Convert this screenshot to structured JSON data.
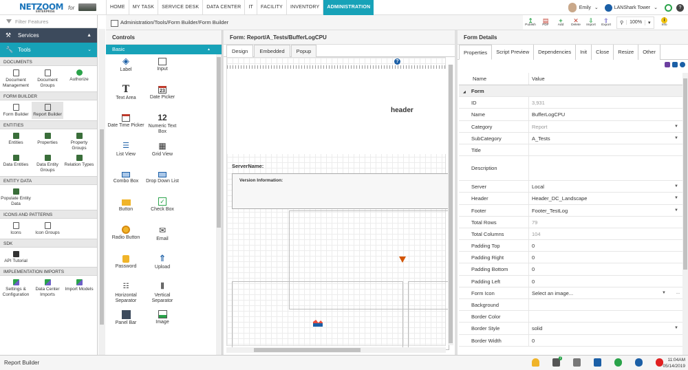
{
  "logo": {
    "name": "NETZOOM",
    "sub": "ENTERPRISE",
    "for": "for"
  },
  "nav": [
    "HOME",
    "MY TASK",
    "SERVICE DESK",
    "DATA CENTER",
    "IT",
    "FACILITY",
    "INVENTORY",
    "ADMINISTRATION"
  ],
  "user": {
    "name": "Emily",
    "site": "LANShark Tower"
  },
  "left": {
    "filter_placeholder": "Filter Features",
    "services": "Services",
    "tools": "Tools",
    "sections": [
      {
        "title": "DOCUMENTS",
        "items": [
          "Document Management",
          "Document Groups",
          "Authorize"
        ]
      },
      {
        "title": "FORM BUILDER",
        "items": [
          "Form Builder",
          "Report Builder"
        ]
      },
      {
        "title": "ENTITIES",
        "items": [
          "Entities",
          "Properties",
          "Property Groups",
          "Data Entities",
          "Data Entity Groups",
          "Relation Types"
        ]
      },
      {
        "title": "ENTITY DATA",
        "items": [
          "Populate Entity Data"
        ]
      },
      {
        "title": "ICONS AND PATTERNS",
        "items": [
          "Icons",
          "Icon Groups"
        ]
      },
      {
        "title": "SDK",
        "items": [
          "API Tutorial"
        ]
      },
      {
        "title": "IMPLEMENTATION IMPORTS",
        "items": [
          "Settings & Configuration",
          "Data Center Imports",
          "Import Models"
        ]
      }
    ]
  },
  "breadcrumb": "Administration/Tools/Form Builder/Form Builder",
  "actions": [
    "Publish",
    "PDF",
    "Add",
    "Delete",
    "Import",
    "Export"
  ],
  "zoom": "100%",
  "info": "Info",
  "controls": {
    "title": "Controls",
    "group": "Basic",
    "items": [
      "Label",
      "Input",
      "Text Area",
      "Date Picker",
      "Date Time Picker",
      "Numeric Text Box",
      "List View",
      "Grid View",
      "Combo Box",
      "Drop Down List",
      "Button",
      "Check Box",
      "Radio Button",
      "Email",
      "Password",
      "Upload",
      "Horizontal Separator",
      "Vertical Separator",
      "Panel Bar",
      "Image"
    ],
    "glyphs": {
      "text_area": "T",
      "date_picker": "23",
      "numeric": "12"
    }
  },
  "form": {
    "title": "Form: Report/A_Tests/BufferLogCPU",
    "tabs": [
      "Design",
      "Embedded",
      "Popup"
    ],
    "header": "header",
    "server_label": "ServerName:",
    "version_label": "Version Information:"
  },
  "details": {
    "title": "Form Details",
    "tabs": [
      "Properties",
      "Script Preview",
      "Dependencies",
      "Init",
      "Close",
      "Resize",
      "Other"
    ],
    "col_name": "Name",
    "col_value": "Value",
    "group": "Form",
    "rows": [
      {
        "n": "ID",
        "v": "3,931",
        "gray": true
      },
      {
        "n": "Name",
        "v": "BufferLogCPU"
      },
      {
        "n": "Category",
        "v": "Report",
        "gray": true,
        "dd": true
      },
      {
        "n": "SubCategory",
        "v": "A_Tests",
        "dd": true
      },
      {
        "n": "Title",
        "v": ""
      },
      {
        "n": "Description",
        "v": "",
        "tall": true
      },
      {
        "n": "Server",
        "v": "Local",
        "dd": true
      },
      {
        "n": "Header",
        "v": "Header_DC_Landscape",
        "dd": true
      },
      {
        "n": "Footer",
        "v": "Footer_TestLog",
        "dd": true
      },
      {
        "n": "Total Rows",
        "v": "79",
        "gray": true
      },
      {
        "n": "Total Columns",
        "v": "104",
        "gray": true
      },
      {
        "n": "Padding Top",
        "v": "0"
      },
      {
        "n": "Padding Right",
        "v": "0"
      },
      {
        "n": "Padding Bottom",
        "v": "0"
      },
      {
        "n": "Padding Left",
        "v": "0"
      },
      {
        "n": "Form Icon",
        "v": "Select an image...",
        "dd": true,
        "ellip": true
      },
      {
        "n": "Background",
        "v": ""
      },
      {
        "n": "Border Color",
        "v": ""
      },
      {
        "n": "Border Style",
        "v": "solid",
        "dd": true
      },
      {
        "n": "Border Width",
        "v": "0"
      }
    ]
  },
  "status": {
    "text": "Report Builder",
    "time": "11:04AM",
    "date": "05/14/2019",
    "badge": "7"
  }
}
